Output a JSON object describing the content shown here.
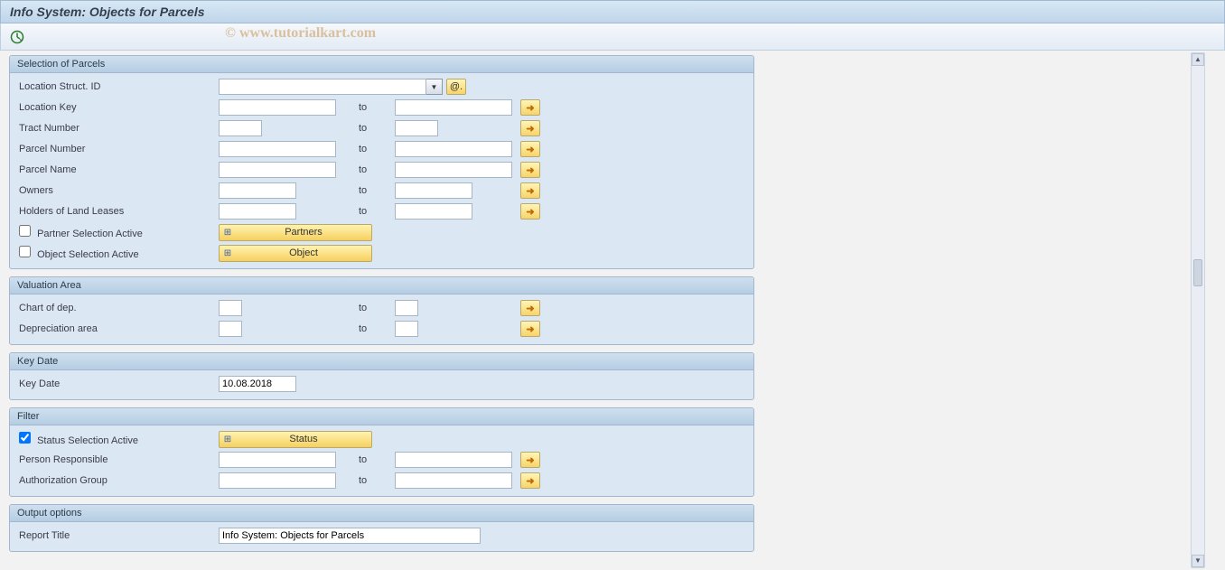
{
  "page_title": "Info System: Objects for Parcels",
  "watermark": "© www.tutorialkart.com",
  "toolbar": {
    "execute_icon": "execute-icon"
  },
  "sections": {
    "parcels": {
      "title": "Selection of Parcels",
      "fields": {
        "loc_struct_id": {
          "label": "Location Struct. ID",
          "value": ""
        },
        "location_key": {
          "label": "Location Key",
          "from": "",
          "to_label": "to",
          "to": ""
        },
        "tract_number": {
          "label": "Tract Number",
          "from": "",
          "to_label": "to",
          "to": ""
        },
        "parcel_number": {
          "label": "Parcel Number",
          "from": "",
          "to_label": "to",
          "to": ""
        },
        "parcel_name": {
          "label": "Parcel Name",
          "from": "",
          "to_label": "to",
          "to": ""
        },
        "owners": {
          "label": "Owners",
          "from": "",
          "to_label": "to",
          "to": ""
        },
        "holders": {
          "label": "Holders of Land Leases",
          "from": "",
          "to_label": "to",
          "to": ""
        },
        "partner_sel": {
          "label": "Partner Selection Active",
          "checked": false,
          "button": "Partners"
        },
        "object_sel": {
          "label": "Object Selection Active",
          "checked": false,
          "button": "Object"
        }
      },
      "at_button": "@."
    },
    "valuation": {
      "title": "Valuation Area",
      "fields": {
        "chart_dep": {
          "label": "Chart of dep.",
          "from": "",
          "to_label": "to",
          "to": ""
        },
        "dep_area": {
          "label": "Depreciation area",
          "from": "",
          "to_label": "to",
          "to": ""
        }
      }
    },
    "keydate": {
      "title": "Key Date",
      "field": {
        "label": "Key Date",
        "value": "10.08.2018"
      }
    },
    "filter": {
      "title": "Filter",
      "fields": {
        "status_sel": {
          "label": "Status Selection Active",
          "checked": true,
          "button": "Status"
        },
        "person": {
          "label": "Person Responsible",
          "from": "",
          "to_label": "to",
          "to": ""
        },
        "auth_group": {
          "label": "Authorization Group",
          "from": "",
          "to_label": "to",
          "to": ""
        }
      }
    },
    "output": {
      "title": "Output options",
      "fields": {
        "report_title": {
          "label": "Report Title",
          "value": "Info System: Objects for Parcels"
        }
      }
    }
  }
}
